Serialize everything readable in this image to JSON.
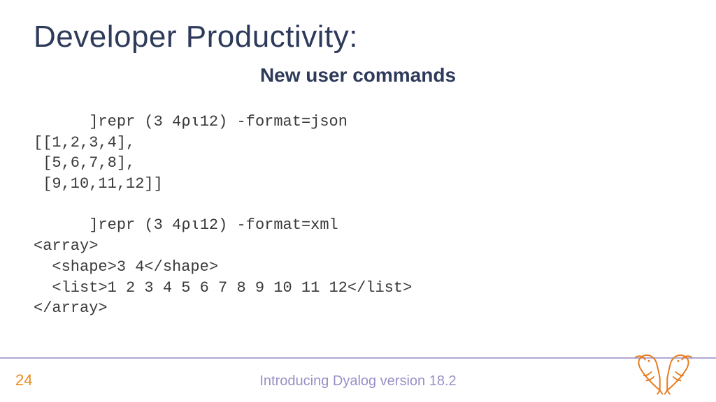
{
  "title": "Developer Productivity:",
  "subtitle": "New user commands",
  "code": "      ]repr (3 4⍴⍳12) -format=json\n[[1,2,3,4],\n [5,6,7,8],\n [9,10,11,12]]\n\n      ]repr (3 4⍴⍳12) -format=xml\n<array>\n  <shape>3 4</shape>\n  <list>1 2 3 4 5 6 7 8 9 10 11 12</list>\n</array>",
  "page_number": "24",
  "footer": "Introducing Dyalog version 18.2",
  "colors": {
    "heading": "#2d3a5a",
    "accent": "#e88b1a",
    "footer_text": "#9a8fc7",
    "divider": "#b8b0d8",
    "logo": "#e8791a"
  }
}
